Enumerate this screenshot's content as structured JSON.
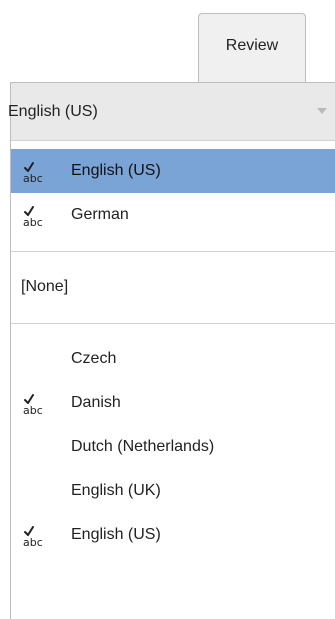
{
  "tab": {
    "label": "Review"
  },
  "language_select": {
    "value": "English (US)"
  },
  "recent_languages": [
    {
      "label": "English (US)",
      "has_spellcheck": true,
      "selected": true
    },
    {
      "label": "German",
      "has_spellcheck": true,
      "selected": false
    }
  ],
  "none_option": {
    "label": "[None]"
  },
  "all_languages": [
    {
      "label": "Czech",
      "has_spellcheck": false
    },
    {
      "label": "Danish",
      "has_spellcheck": true
    },
    {
      "label": "Dutch (Netherlands)",
      "has_spellcheck": false
    },
    {
      "label": "English (UK)",
      "has_spellcheck": false
    },
    {
      "label": "English (US)",
      "has_spellcheck": true
    }
  ],
  "icons": {
    "spellcheck": "spellcheck-icon",
    "dropdown": "chevron-down-icon"
  },
  "colors": {
    "selected_background": "#7aa3d6",
    "select_bar_background": "#e9e9e9"
  }
}
